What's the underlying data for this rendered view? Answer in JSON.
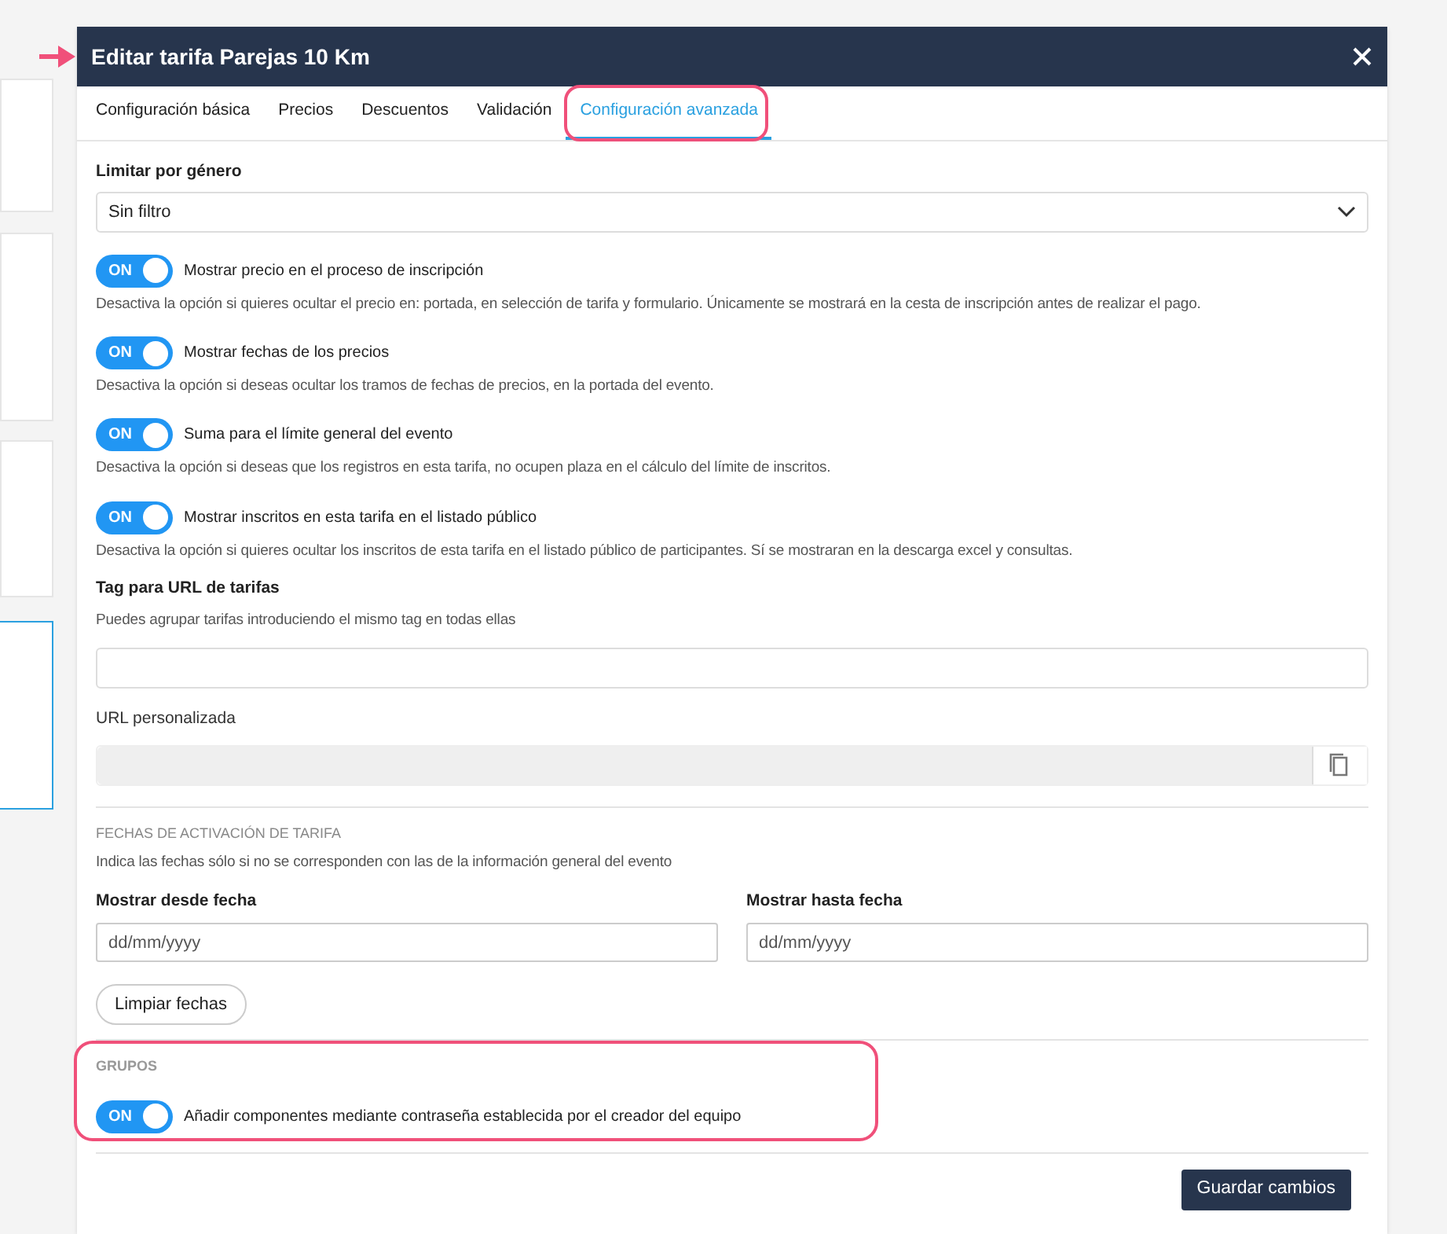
{
  "window": {
    "title": "Editar tarifa Parejas 10 Km"
  },
  "tabs": [
    {
      "label": "Configuración básica",
      "selected": false
    },
    {
      "label": "Precios",
      "selected": false
    },
    {
      "label": "Descuentos",
      "selected": false
    },
    {
      "label": "Validación",
      "selected": false
    },
    {
      "label": "Configuración avanzada",
      "selected": true
    }
  ],
  "gender_filter": {
    "label": "Limitar por género",
    "value": "Sin filtro"
  },
  "toggles": [
    {
      "label": "Mostrar precio en el proceso de inscripción",
      "on": true,
      "switch_text": "ON",
      "description": "Desactiva la opción si quieres ocultar el precio en: portada, en selección de tarifa y formulario. Únicamente se mostrará en la cesta de inscripción antes de realizar el pago."
    },
    {
      "label": "Mostrar fechas de los precios",
      "on": true,
      "switch_text": "ON",
      "description": "Desactiva la opción si deseas ocultar los tramos de fechas de precios, en la portada del evento."
    },
    {
      "label": "Suma para el límite general del evento",
      "on": true,
      "switch_text": "ON",
      "description": "Desactiva la opción si deseas que los registros en esta tarifa, no ocupen plaza en el cálculo del límite de inscritos."
    },
    {
      "label": "Mostrar inscritos en esta tarifa en el listado público",
      "on": true,
      "switch_text": "ON",
      "description": "Desactiva la opción si quieres ocultar los inscritos de esta tarifa en el listado público de participantes. Sí se mostraran en la descarga excel y consultas."
    }
  ],
  "tag": {
    "label": "Tag para URL de tarifas",
    "hint": "Puedes agrupar tarifas introduciendo el mismo tag en todas ellas"
  },
  "custom_url": {
    "label": "URL personalizada",
    "disabled": true
  },
  "activation_dates": {
    "heading": "FECHAS DE ACTIVACIÓN DE TARIFA",
    "hint": "Indica las fechas sólo si no se corresponden con las de la información general del evento",
    "from": {
      "label": "Mostrar desde fecha",
      "placeholder": "dd/mm/yyyy"
    },
    "to": {
      "label": "Mostrar hasta fecha",
      "placeholder": "dd/mm/yyyy"
    },
    "clear_button": "Limpiar fechas"
  },
  "groups": {
    "heading": "GRUPOS",
    "toggle": {
      "label": "Añadir componentes mediante contraseña establecida por el creador del equipo",
      "on": true,
      "switch_text": "ON"
    }
  },
  "save_button": "Guardar cambios"
}
